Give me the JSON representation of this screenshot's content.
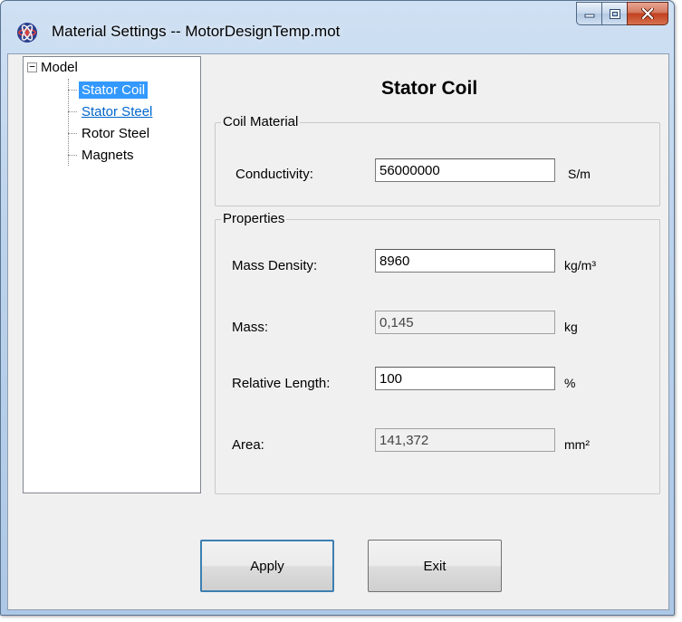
{
  "window": {
    "title": "Material Settings -- MotorDesignTemp.mot",
    "app_icon": "atom-icon",
    "caption_buttons": [
      "minimize-icon",
      "maximize-icon",
      "close-icon"
    ],
    "close_color": "#c2401f"
  },
  "tree": {
    "root_label": "Model",
    "expander_symbol": "−",
    "items": [
      {
        "label": "Stator Coil",
        "state": "selected"
      },
      {
        "label": "Stator Steel",
        "state": "link"
      },
      {
        "label": "Rotor Steel",
        "state": "normal"
      },
      {
        "label": "Magnets",
        "state": "normal"
      }
    ],
    "selection_color": "#3399ff"
  },
  "panel": {
    "title": "Stator Coil",
    "coil_group": {
      "label": "Coil Material",
      "conductivity_label": "Conductivity:",
      "conductivity_value": "56000000",
      "conductivity_unit": "S/m"
    },
    "properties_group": {
      "label": "Properties",
      "mass_density_label": "Mass Density:",
      "mass_density_value": "8960",
      "mass_density_unit": "kg/m³",
      "mass_label": "Mass:",
      "mass_value": "0,145",
      "mass_unit": "kg",
      "relative_length_label": "Relative Length:",
      "relative_length_value": "100",
      "relative_length_unit": "%",
      "area_label": "Area:",
      "area_value": "141,372",
      "area_unit": "mm²"
    }
  },
  "buttons": {
    "apply": "Apply",
    "exit": "Exit"
  }
}
